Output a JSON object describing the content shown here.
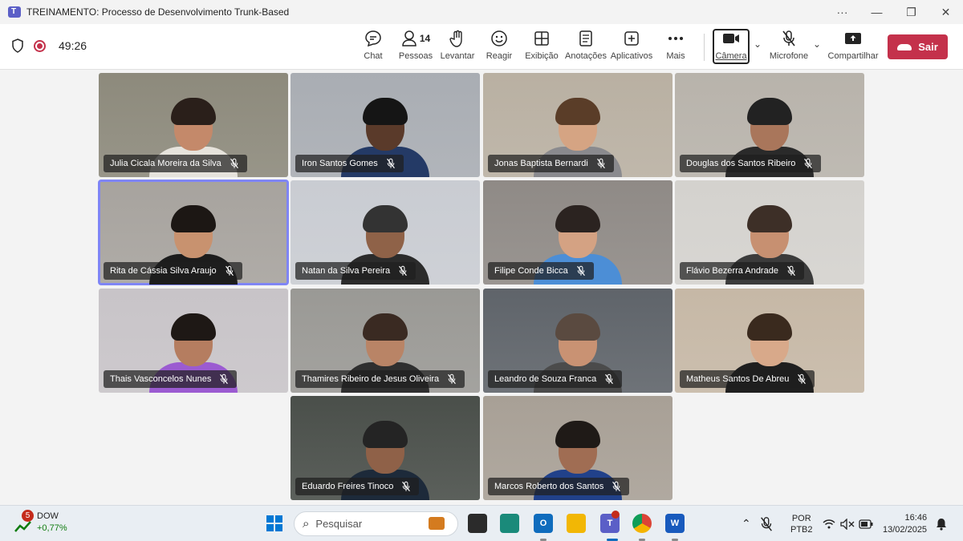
{
  "window": {
    "title": "TREINAMENTO: Processo de Desenvolvimento Trunk-Based",
    "more": "···",
    "minimize": "—",
    "restore": "❐",
    "close": "✕"
  },
  "toolbar": {
    "timer": "49:26",
    "buttons": {
      "chat": "Chat",
      "people": "Pessoas",
      "people_count": "14",
      "raise": "Levantar",
      "react": "Reagir",
      "view": "Exibição",
      "notes": "Anotações",
      "apps": "Aplicativos",
      "more": "Mais",
      "camera": "Câmera",
      "mic": "Microfone",
      "share": "Compartilhar",
      "leave": "Sair"
    }
  },
  "participants": [
    {
      "name": "Julia Cicala Moreira da Silva",
      "bg": "#8d8a7c",
      "skin": "#c4896a",
      "hair": "#2a1f1a",
      "shirt": "#e6e3dc"
    },
    {
      "name": "Iron Santos Gomes",
      "bg": "#a9adb3",
      "skin": "#5a3a2a",
      "hair": "#151515",
      "shirt": "#243a66"
    },
    {
      "name": "Jonas Baptista Bernardi",
      "bg": "#b9b0a2",
      "skin": "#d5a483",
      "hair": "#5a3d28",
      "shirt": "#8a8a8e"
    },
    {
      "name": "Douglas dos Santos Ribeiro",
      "bg": "#b8b3ab",
      "skin": "#a9765b",
      "hair": "#222222",
      "shirt": "#2a2a2a"
    },
    {
      "name": "Rita de Cássia Silva Araujo",
      "bg": "#a7a39e",
      "skin": "#c8926f",
      "hair": "#1c1714",
      "shirt": "#1c1c1c"
    },
    {
      "name": "Natan da Silva Pereira",
      "bg": "#c9ccd2",
      "skin": "#8f6248",
      "hair": "#333333",
      "shirt": "#2b2b2b"
    },
    {
      "name": "Filipe Conde Bicca",
      "bg": "#8f8a86",
      "skin": "#d4a283",
      "hair": "#2b2320",
      "shirt": "#4c8ed6"
    },
    {
      "name": "Flávio Bezerra Andrade",
      "bg": "#d4d2ce",
      "skin": "#c79071",
      "hair": "#3d2f27",
      "shirt": "#3b3b3b"
    },
    {
      "name": "Thais Vasconcelos Nunes",
      "bg": "#c8c4c8",
      "skin": "#b57d60",
      "hair": "#1e1815",
      "shirt": "#9b5bd1"
    },
    {
      "name": "Thamires Ribeiro de Jesus Oliveira",
      "bg": "#9a9995",
      "skin": "#b98466",
      "hair": "#3a2a22",
      "shirt": "#2f2f2f"
    },
    {
      "name": "Leandro de Souza Franca",
      "bg": "#5f646a",
      "skin": "#c99273",
      "hair": "#5a4a40",
      "shirt": "#4b4b4b"
    },
    {
      "name": "Matheus Santos De Abreu",
      "bg": "#c6b8a6",
      "skin": "#d8a98a",
      "hair": "#3a2a1e",
      "shirt": "#1f1f1f"
    },
    {
      "name": "Eduardo Freires Tinoco",
      "bg": "#4a4f4a",
      "skin": "#8f6148",
      "hair": "#242424",
      "shirt": "#1d2a3a"
    },
    {
      "name": "Marcos Roberto dos Santos",
      "bg": "#a8a096",
      "skin": "#a06d53",
      "hair": "#1f1a17",
      "shirt": "#21418a"
    }
  ],
  "taskbar": {
    "widget": {
      "badge": "5",
      "name": "DOW",
      "change": "+0,77%"
    },
    "search_placeholder": "Pesquisar",
    "lang_line1": "POR",
    "lang_line2": "PTB2",
    "time": "16:46",
    "date": "13/02/2025"
  }
}
